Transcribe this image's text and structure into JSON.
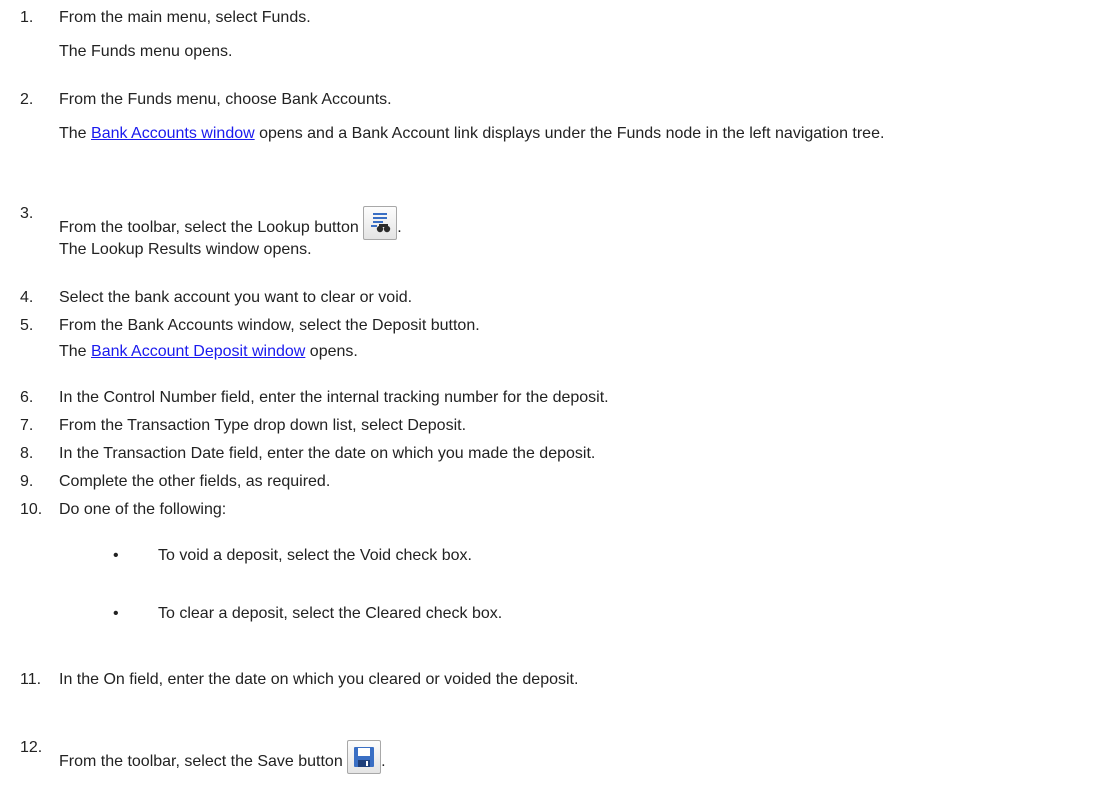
{
  "steps": [
    {
      "num": "1.",
      "text": "From the main menu, select Funds.",
      "result": "The Funds menu opens."
    },
    {
      "num": "2.",
      "text": "From the Funds menu, choose Bank Accounts.",
      "result_link": "Bank Accounts window",
      "result_rest": " opens and a Bank Account link displays under the Funds node in the left navigation tree."
    },
    {
      "num": "3.",
      "text": "From the toolbar, select the Lookup button",
      "icon": "lookup-binoculars-icon",
      "result": "The Lookup Results window opens."
    },
    {
      "num": "4.",
      "text": "Select the bank account you want to clear or void."
    },
    {
      "num": "5.",
      "text": "From the Bank Accounts window, select the Deposit button.",
      "result_pre": "The ",
      "result_link": "Bank Account Deposit window",
      "result_rest": " opens."
    },
    {
      "num": "6.",
      "text": "In the Control Number field, enter the internal tracking number for the deposit."
    },
    {
      "num": "7.",
      "text": "From the Transaction Type drop down list, select Deposit."
    },
    {
      "num": "8.",
      "text": "In the Transaction Date field, enter the date on which you made the deposit."
    },
    {
      "num": "9.",
      "text": "Complete the other fields, as required."
    },
    {
      "num": "10.",
      "text": "Do one of the following:",
      "bullets": [
        "To void a deposit, select the Void check box.",
        "To clear a deposit, select the Cleared check box."
      ]
    },
    {
      "num": "11.",
      "text": "In the On field, enter the date on which you cleared or voided the deposit."
    },
    {
      "num": "12.",
      "text": "From the toolbar, select the Save button",
      "icon": "save-floppy-icon"
    }
  ],
  "bullet_char": "•",
  "period": ".",
  "colors": {
    "link": "#1a1aee",
    "text": "#222222",
    "icon_blue": "#3a6fc4"
  }
}
